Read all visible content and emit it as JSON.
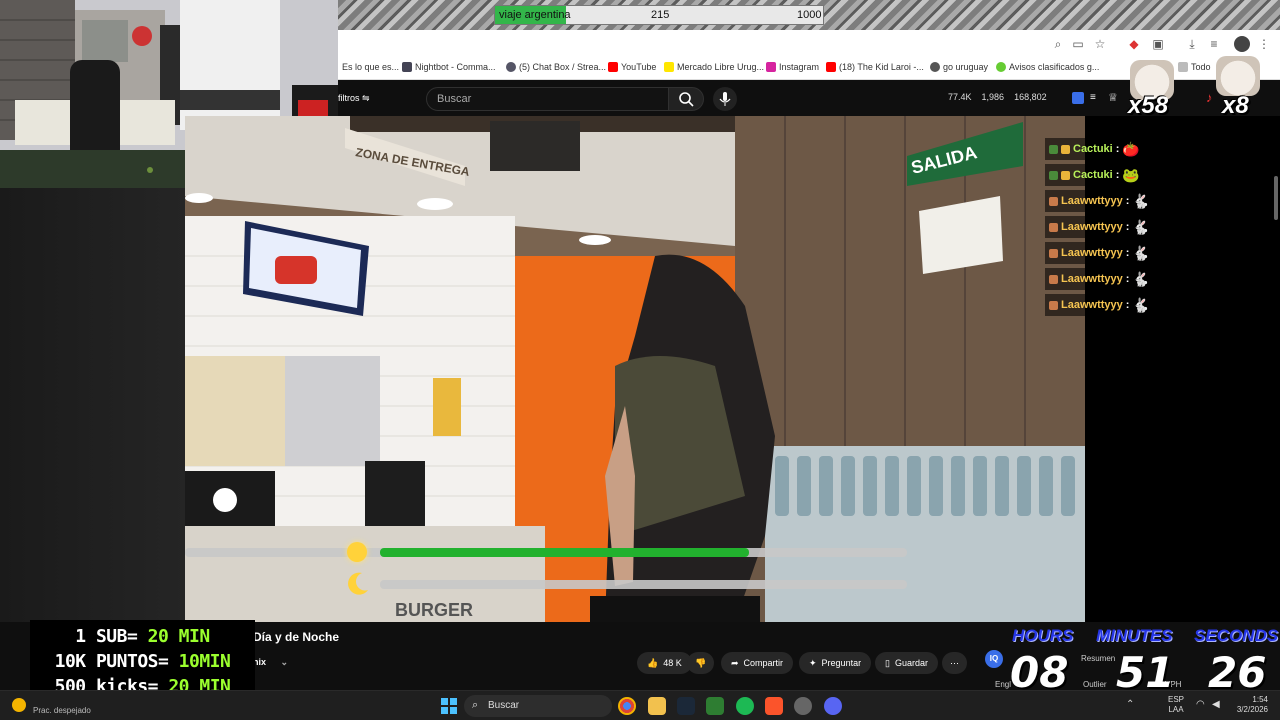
{
  "goal": {
    "label": "viaje argentina",
    "current": "215",
    "target": "1000",
    "progress": 0.215
  },
  "bookmarks": [
    "Es lo que es...",
    "Nightbot - Comma...",
    "(5) Chat Box / Strea...",
    "YouTube",
    "Mercado Libre Urug...",
    "Instagram",
    "(18) The Kid Laroi -...",
    "go uruguay",
    "Avisos clasificados g...",
    "Todo"
  ],
  "youtube": {
    "filters_label": "filtros",
    "search_placeholder": "Buscar",
    "stats": [
      "77.4K",
      "1,986",
      "168,802"
    ],
    "title_fragment": "Día y de Noche",
    "channel_fragment": "nix",
    "likes": "48 K",
    "share": "Compartir",
    "ask": "Preguntar",
    "save": "Guardar",
    "summary": "Resumen",
    "outlier": "Outlier",
    "vph": "VPH",
    "engl": "Engl",
    "iq": "IQ"
  },
  "video_signs": {
    "zona": "ZONA DE ENTREGA",
    "salida": "SALIDA",
    "burger": "BURGER"
  },
  "day_night": {
    "day_progress": 0.7,
    "night_progress": 0.0
  },
  "chat": [
    {
      "user": "Cactuki",
      "color": "#b8f05a"
    },
    {
      "user": "Cactuki",
      "color": "#b8f05a"
    },
    {
      "user": "Laawwttyyy",
      "color": "#f5c451"
    },
    {
      "user": "Laawwttyyy",
      "color": "#f5c451"
    },
    {
      "user": "Laawwttyyy",
      "color": "#f5c451"
    },
    {
      "user": "Laawwttyyy",
      "color": "#f5c451"
    },
    {
      "user": "Laawwttyyy",
      "color": "#f5c451"
    }
  ],
  "emote_counts": {
    "a": "x58",
    "b": "x8"
  },
  "rewards": {
    "l1": {
      "a": "1 SUB= ",
      "b": "20 MIN"
    },
    "l2": {
      "a": "10K PUNTOS= ",
      "b": "10MIN"
    },
    "l3": {
      "a": "500 kicks= ",
      "b": "20 MIN"
    }
  },
  "timer": {
    "h_label": "HOURS",
    "m_label": "MINUTES",
    "s_label": "SECONDS",
    "hours": "08",
    "minutes": "51",
    "seconds": "26"
  },
  "taskbar": {
    "weather": "Prac. despejado",
    "search": "Buscar",
    "lang1": "ESP",
    "lang2": "LAA",
    "time": "1:54",
    "date": "3/2/2026"
  },
  "colors": {
    "accent_green": "#9bff2e",
    "timer_blue": "#2636e6",
    "progress_green": "#22b12e"
  }
}
